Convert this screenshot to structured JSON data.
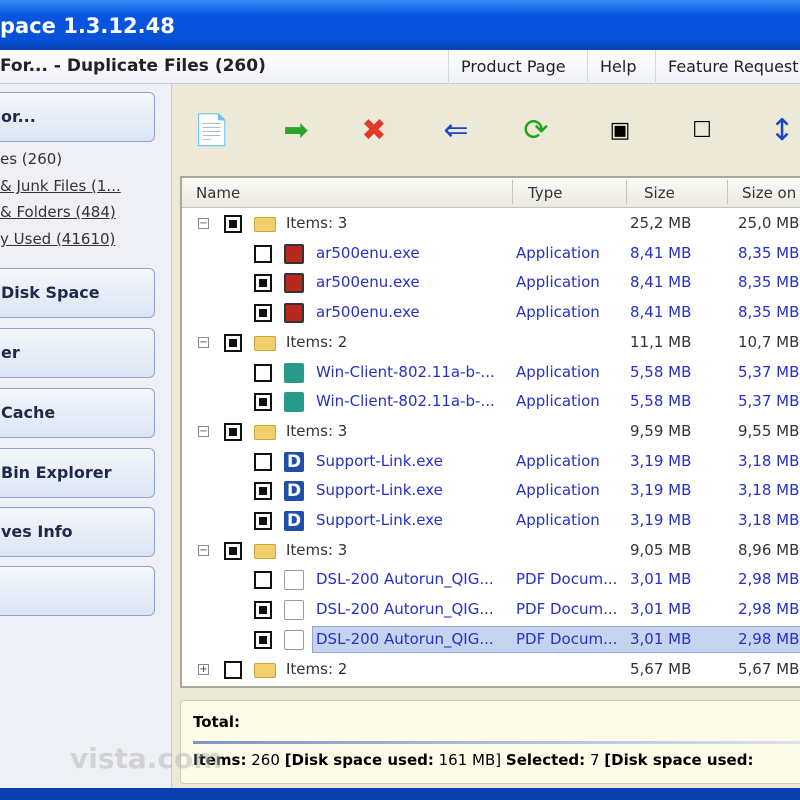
{
  "window": {
    "title": "pace 1.3.12.48"
  },
  "header": {
    "title": "For... - Duplicate Files (260)",
    "links": [
      "Product Page",
      "Help",
      "Feature Request"
    ]
  },
  "sidebar": {
    "top_button": "or...",
    "links": [
      "es (260)",
      "& Junk Files (1...",
      "& Folders (484)",
      "y Used (41610)"
    ],
    "buttons": [
      "Disk Space",
      "er",
      "Cache",
      "Bin Explorer",
      "ves Info",
      ""
    ]
  },
  "toolbar": {
    "icons": [
      "copy-to-icon",
      "move-to-icon",
      "delete-icon",
      "select-first-icon",
      "refresh-icon",
      "check-all-icon",
      "uncheck-all-icon",
      "invert-selection-icon"
    ]
  },
  "list": {
    "columns": [
      "Name",
      "Type",
      "Size",
      "Size on"
    ],
    "rows": [
      {
        "kind": "group",
        "checked": true,
        "expanded": true,
        "name": "Items: 3",
        "type": "",
        "size": "25,2 MB",
        "size_on": "25,0 MB"
      },
      {
        "kind": "file",
        "icon": "exe",
        "checked": false,
        "name": "ar500enu.exe",
        "type": "Application",
        "size": "8,41 MB",
        "size_on": "8,35 MB"
      },
      {
        "kind": "file",
        "icon": "exe",
        "checked": true,
        "name": "ar500enu.exe",
        "type": "Application",
        "size": "8,41 MB",
        "size_on": "8,35 MB"
      },
      {
        "kind": "file",
        "icon": "exe",
        "checked": true,
        "name": "ar500enu.exe",
        "type": "Application",
        "size": "8,41 MB",
        "size_on": "8,35 MB"
      },
      {
        "kind": "group",
        "checked": true,
        "expanded": true,
        "name": "Items: 2",
        "type": "",
        "size": "11,1 MB",
        "size_on": "10,7 MB"
      },
      {
        "kind": "file",
        "icon": "wifi",
        "checked": false,
        "name": "Win-Client-802.11a-b-...",
        "type": "Application",
        "size": "5,58 MB",
        "size_on": "5,37 MB"
      },
      {
        "kind": "file",
        "icon": "wifi",
        "checked": true,
        "name": "Win-Client-802.11a-b-...",
        "type": "Application",
        "size": "5,58 MB",
        "size_on": "5,37 MB"
      },
      {
        "kind": "group",
        "checked": true,
        "expanded": true,
        "name": "Items: 3",
        "type": "",
        "size": "9,59 MB",
        "size_on": "9,55 MB"
      },
      {
        "kind": "file",
        "icon": "d",
        "checked": false,
        "name": "Support-Link.exe",
        "type": "Application",
        "size": "3,19 MB",
        "size_on": "3,18 MB"
      },
      {
        "kind": "file",
        "icon": "d",
        "checked": true,
        "name": "Support-Link.exe",
        "type": "Application",
        "size": "3,19 MB",
        "size_on": "3,18 MB"
      },
      {
        "kind": "file",
        "icon": "d",
        "checked": true,
        "name": "Support-Link.exe",
        "type": "Application",
        "size": "3,19 MB",
        "size_on": "3,18 MB"
      },
      {
        "kind": "group",
        "checked": true,
        "expanded": true,
        "name": "Items: 3",
        "type": "",
        "size": "9,05 MB",
        "size_on": "8,96 MB"
      },
      {
        "kind": "file",
        "icon": "pdf",
        "checked": false,
        "name": "DSL-200 Autorun_QIG...",
        "type": "PDF Docum...",
        "size": "3,01 MB",
        "size_on": "2,98 MB"
      },
      {
        "kind": "file",
        "icon": "pdf",
        "checked": true,
        "name": "DSL-200 Autorun_QIG...",
        "type": "PDF Docum...",
        "size": "3,01 MB",
        "size_on": "2,98 MB"
      },
      {
        "kind": "file",
        "icon": "pdf",
        "checked": true,
        "selected": true,
        "name": "DSL-200 Autorun_QIG...",
        "type": "PDF Docum...",
        "size": "3,01 MB",
        "size_on": "2,98 MB"
      },
      {
        "kind": "group",
        "checked": false,
        "expanded": false,
        "name": "Items: 2",
        "type": "",
        "size": "5,67 MB",
        "size_on": "5,67 MB"
      }
    ]
  },
  "footer": {
    "total_label": "Total:",
    "items_label": "Items:",
    "items": "260",
    "disk_label": "[Disk space used:",
    "disk": "161 MB]",
    "selected_label": "Selected:",
    "selected": "7",
    "disk2_label": "[Disk space used:"
  },
  "watermark": "vista.com"
}
